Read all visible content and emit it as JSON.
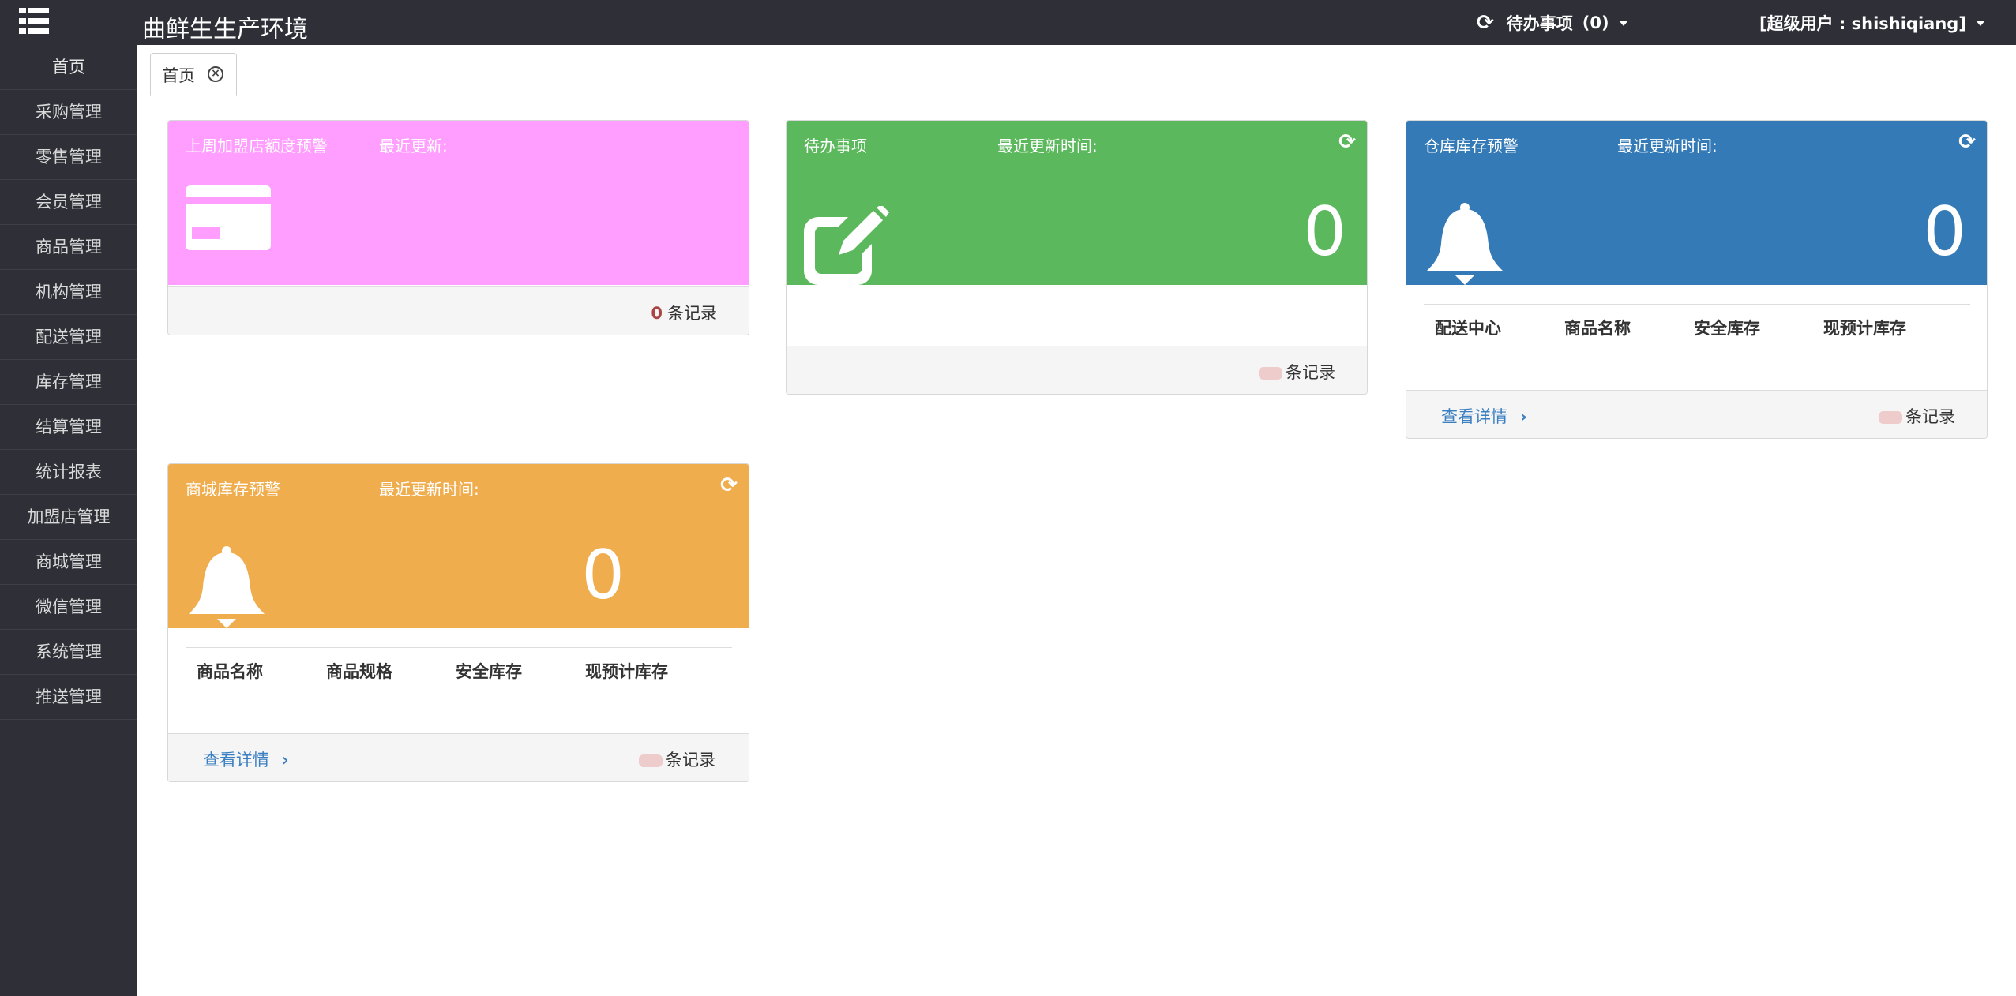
{
  "header": {
    "app_title": "曲鲜生生产环境",
    "todo_label": "待办事项",
    "todo_count": "(0)",
    "user_label": "[超级用户 : shishiqiang]"
  },
  "sidebar": {
    "items": [
      {
        "label": "首页"
      },
      {
        "label": "采购管理"
      },
      {
        "label": "零售管理"
      },
      {
        "label": "会员管理"
      },
      {
        "label": "商品管理"
      },
      {
        "label": "机构管理"
      },
      {
        "label": "配送管理"
      },
      {
        "label": "库存管理"
      },
      {
        "label": "结算管理"
      },
      {
        "label": "统计报表"
      },
      {
        "label": "加盟店管理"
      },
      {
        "label": "商城管理"
      },
      {
        "label": "微信管理"
      },
      {
        "label": "系统管理"
      },
      {
        "label": "推送管理"
      }
    ]
  },
  "tabs": [
    {
      "label": "首页"
    }
  ],
  "panels": {
    "franchise": {
      "title": "上周加盟店额度预警",
      "update_label": "最近更新:",
      "record_count": "0",
      "record_suffix": "条记录",
      "color": "#ff9eff"
    },
    "todo": {
      "title": "待办事项",
      "update_label": "最近更新时间:",
      "count": "0",
      "record_suffix": "条记录",
      "color": "#5cb85c"
    },
    "warehouse": {
      "title": "仓库库存预警",
      "update_label": "最近更新时间:",
      "count": "0",
      "columns": [
        "配送中心",
        "商品名称",
        "安全库存",
        "现预计库存"
      ],
      "detail_label": "查看详情",
      "record_suffix": "条记录",
      "color": "#337ab7"
    },
    "mall": {
      "title": "商城库存预警",
      "update_label": "最近更新时间:",
      "count": "0",
      "columns": [
        "商品名称",
        "商品规格",
        "安全库存",
        "现预计库存"
      ],
      "detail_label": "查看详情",
      "record_suffix": "条记录",
      "color": "#f0ad4e"
    }
  }
}
